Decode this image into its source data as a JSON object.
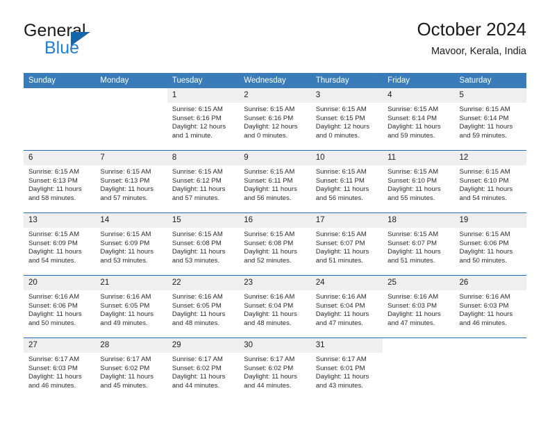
{
  "brand": {
    "word_general": "General",
    "word_blue": "Blue",
    "triangle_color": "#1565a8",
    "blue_text_color": "#1f7fd0"
  },
  "header": {
    "title": "October 2024",
    "subtitle": "Mavoor, Kerala, India"
  },
  "theme": {
    "header_blue": "#3a7cb9",
    "row_divider_blue": "#1f6cb0",
    "daynum_band": "#efefef"
  },
  "calendar": {
    "day_headers": [
      "Sunday",
      "Monday",
      "Tuesday",
      "Wednesday",
      "Thursday",
      "Friday",
      "Saturday"
    ],
    "weeks": [
      [
        {
          "day": "",
          "lines": [],
          "blank": true
        },
        {
          "day": "",
          "lines": [],
          "blank": true
        },
        {
          "day": "1",
          "lines": [
            "Sunrise: 6:15 AM",
            "Sunset: 6:16 PM",
            "Daylight: 12 hours",
            "and 1 minute."
          ]
        },
        {
          "day": "2",
          "lines": [
            "Sunrise: 6:15 AM",
            "Sunset: 6:16 PM",
            "Daylight: 12 hours",
            "and 0 minutes."
          ]
        },
        {
          "day": "3",
          "lines": [
            "Sunrise: 6:15 AM",
            "Sunset: 6:15 PM",
            "Daylight: 12 hours",
            "and 0 minutes."
          ]
        },
        {
          "day": "4",
          "lines": [
            "Sunrise: 6:15 AM",
            "Sunset: 6:14 PM",
            "Daylight: 11 hours",
            "and 59 minutes."
          ]
        },
        {
          "day": "5",
          "lines": [
            "Sunrise: 6:15 AM",
            "Sunset: 6:14 PM",
            "Daylight: 11 hours",
            "and 59 minutes."
          ]
        }
      ],
      [
        {
          "day": "6",
          "lines": [
            "Sunrise: 6:15 AM",
            "Sunset: 6:13 PM",
            "Daylight: 11 hours",
            "and 58 minutes."
          ]
        },
        {
          "day": "7",
          "lines": [
            "Sunrise: 6:15 AM",
            "Sunset: 6:13 PM",
            "Daylight: 11 hours",
            "and 57 minutes."
          ]
        },
        {
          "day": "8",
          "lines": [
            "Sunrise: 6:15 AM",
            "Sunset: 6:12 PM",
            "Daylight: 11 hours",
            "and 57 minutes."
          ]
        },
        {
          "day": "9",
          "lines": [
            "Sunrise: 6:15 AM",
            "Sunset: 6:11 PM",
            "Daylight: 11 hours",
            "and 56 minutes."
          ]
        },
        {
          "day": "10",
          "lines": [
            "Sunrise: 6:15 AM",
            "Sunset: 6:11 PM",
            "Daylight: 11 hours",
            "and 56 minutes."
          ]
        },
        {
          "day": "11",
          "lines": [
            "Sunrise: 6:15 AM",
            "Sunset: 6:10 PM",
            "Daylight: 11 hours",
            "and 55 minutes."
          ]
        },
        {
          "day": "12",
          "lines": [
            "Sunrise: 6:15 AM",
            "Sunset: 6:10 PM",
            "Daylight: 11 hours",
            "and 54 minutes."
          ]
        }
      ],
      [
        {
          "day": "13",
          "lines": [
            "Sunrise: 6:15 AM",
            "Sunset: 6:09 PM",
            "Daylight: 11 hours",
            "and 54 minutes."
          ]
        },
        {
          "day": "14",
          "lines": [
            "Sunrise: 6:15 AM",
            "Sunset: 6:09 PM",
            "Daylight: 11 hours",
            "and 53 minutes."
          ]
        },
        {
          "day": "15",
          "lines": [
            "Sunrise: 6:15 AM",
            "Sunset: 6:08 PM",
            "Daylight: 11 hours",
            "and 53 minutes."
          ]
        },
        {
          "day": "16",
          "lines": [
            "Sunrise: 6:15 AM",
            "Sunset: 6:08 PM",
            "Daylight: 11 hours",
            "and 52 minutes."
          ]
        },
        {
          "day": "17",
          "lines": [
            "Sunrise: 6:15 AM",
            "Sunset: 6:07 PM",
            "Daylight: 11 hours",
            "and 51 minutes."
          ]
        },
        {
          "day": "18",
          "lines": [
            "Sunrise: 6:15 AM",
            "Sunset: 6:07 PM",
            "Daylight: 11 hours",
            "and 51 minutes."
          ]
        },
        {
          "day": "19",
          "lines": [
            "Sunrise: 6:15 AM",
            "Sunset: 6:06 PM",
            "Daylight: 11 hours",
            "and 50 minutes."
          ]
        }
      ],
      [
        {
          "day": "20",
          "lines": [
            "Sunrise: 6:16 AM",
            "Sunset: 6:06 PM",
            "Daylight: 11 hours",
            "and 50 minutes."
          ]
        },
        {
          "day": "21",
          "lines": [
            "Sunrise: 6:16 AM",
            "Sunset: 6:05 PM",
            "Daylight: 11 hours",
            "and 49 minutes."
          ]
        },
        {
          "day": "22",
          "lines": [
            "Sunrise: 6:16 AM",
            "Sunset: 6:05 PM",
            "Daylight: 11 hours",
            "and 48 minutes."
          ]
        },
        {
          "day": "23",
          "lines": [
            "Sunrise: 6:16 AM",
            "Sunset: 6:04 PM",
            "Daylight: 11 hours",
            "and 48 minutes."
          ]
        },
        {
          "day": "24",
          "lines": [
            "Sunrise: 6:16 AM",
            "Sunset: 6:04 PM",
            "Daylight: 11 hours",
            "and 47 minutes."
          ]
        },
        {
          "day": "25",
          "lines": [
            "Sunrise: 6:16 AM",
            "Sunset: 6:03 PM",
            "Daylight: 11 hours",
            "and 47 minutes."
          ]
        },
        {
          "day": "26",
          "lines": [
            "Sunrise: 6:16 AM",
            "Sunset: 6:03 PM",
            "Daylight: 11 hours",
            "and 46 minutes."
          ]
        }
      ],
      [
        {
          "day": "27",
          "lines": [
            "Sunrise: 6:17 AM",
            "Sunset: 6:03 PM",
            "Daylight: 11 hours",
            "and 46 minutes."
          ]
        },
        {
          "day": "28",
          "lines": [
            "Sunrise: 6:17 AM",
            "Sunset: 6:02 PM",
            "Daylight: 11 hours",
            "and 45 minutes."
          ]
        },
        {
          "day": "29",
          "lines": [
            "Sunrise: 6:17 AM",
            "Sunset: 6:02 PM",
            "Daylight: 11 hours",
            "and 44 minutes."
          ]
        },
        {
          "day": "30",
          "lines": [
            "Sunrise: 6:17 AM",
            "Sunset: 6:02 PM",
            "Daylight: 11 hours",
            "and 44 minutes."
          ]
        },
        {
          "day": "31",
          "lines": [
            "Sunrise: 6:17 AM",
            "Sunset: 6:01 PM",
            "Daylight: 11 hours",
            "and 43 minutes."
          ]
        },
        {
          "day": "",
          "lines": [],
          "blank": true
        },
        {
          "day": "",
          "lines": [],
          "blank": true
        }
      ]
    ]
  }
}
